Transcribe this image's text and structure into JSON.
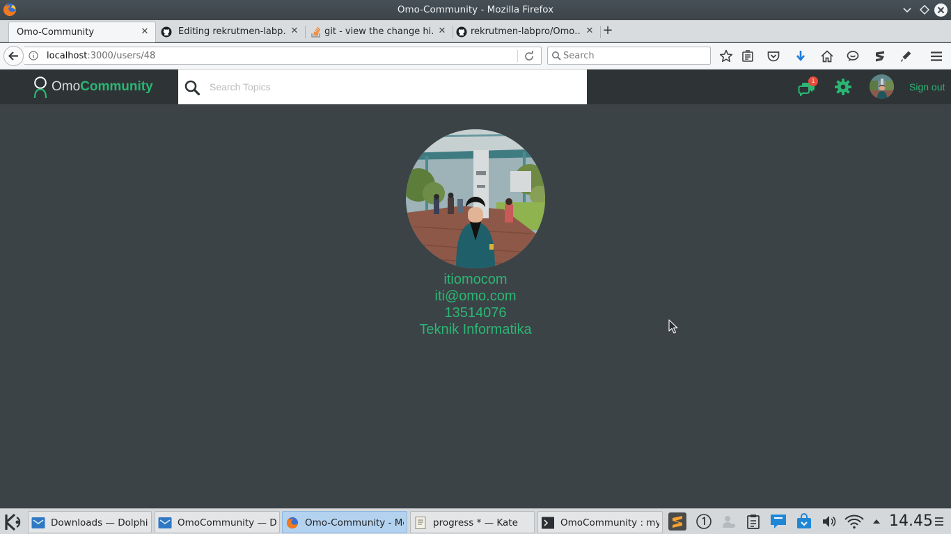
{
  "window": {
    "title": "Omo-Community - Mozilla Firefox",
    "icon": "firefox-icon"
  },
  "tabs": [
    {
      "label": "Omo-Community",
      "active": true,
      "icon": null
    },
    {
      "label": "Editing rekrutmen-labp…",
      "active": false,
      "icon": "github-icon"
    },
    {
      "label": "git - view the change hi…",
      "active": false,
      "icon": "stackoverflow-icon"
    },
    {
      "label": "rekrutmen-labpro/Omo…",
      "active": false,
      "icon": "github-icon"
    }
  ],
  "navbar": {
    "url_host": "localhost",
    "url_path": ":3000/users/48",
    "search_placeholder": "Search"
  },
  "app": {
    "brand_light": "Omo",
    "brand_bold": "Community",
    "search_placeholder": "Search Topics",
    "notification_count": "1",
    "signout_label": "Sign out"
  },
  "profile": {
    "username": "itiomocom",
    "email": "iti@omo.com",
    "nim": "13514076",
    "major": "Teknik Informatika"
  },
  "taskbar": {
    "tasks": [
      {
        "label": "Downloads — Dolphin",
        "icon": "dolphin-icon",
        "active": false
      },
      {
        "label": "OmoCommunity — Dol",
        "icon": "dolphin-icon",
        "active": false
      },
      {
        "label": "Omo-Community - Moz",
        "icon": "firefox-icon",
        "active": true
      },
      {
        "label": "progress * — Kate",
        "icon": "kate-icon",
        "active": false
      },
      {
        "label": "OmoCommunity : myse",
        "icon": "terminal-icon",
        "active": false
      }
    ],
    "clock": "14.45"
  },
  "colors": {
    "accent": "#2bb673",
    "header_bg": "#2e3336",
    "page_bg": "#3c4347",
    "badge": "#e74c3c"
  }
}
